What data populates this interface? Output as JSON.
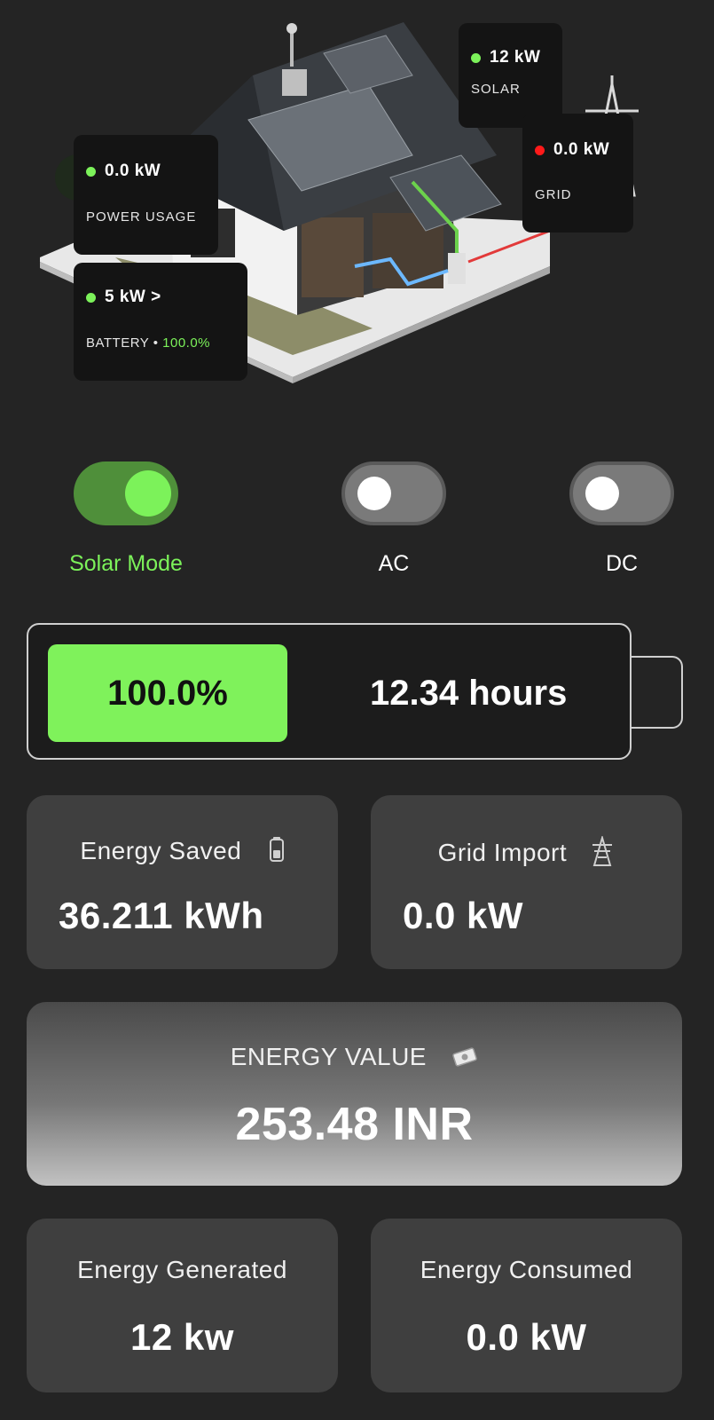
{
  "status": {
    "solar": {
      "value": "12 kW",
      "label": "SOLAR",
      "dot": "#7cf25a"
    },
    "grid": {
      "value": "0.0 kW",
      "label": "GRID",
      "dot": "#ff1a1a"
    },
    "power_usage": {
      "value": "0.0 kW",
      "label": "POWER USAGE",
      "dot": "#7cf25a"
    },
    "battery": {
      "value": "5 kW >",
      "label": "BATTERY",
      "separator": "•",
      "percent": "100.0%",
      "dot": "#7cf25a"
    }
  },
  "modes": [
    {
      "label": "Solar Mode",
      "on": true
    },
    {
      "label": "AC",
      "on": false
    },
    {
      "label": "DC",
      "on": false
    }
  ],
  "battery_bar": {
    "percent_text": "100.0%",
    "level": 1.0,
    "hours": "12.34 hours"
  },
  "cards": {
    "energy_saved": {
      "title": "Energy Saved",
      "value": "36.211 kWh",
      "icon": "battery-icon"
    },
    "grid_import": {
      "title": "Grid Import",
      "value": "0.0 kW",
      "icon": "transmission-tower-icon"
    },
    "energy_value": {
      "title": "ENERGY VALUE",
      "value": "253.48 INR",
      "icon": "money-icon"
    },
    "energy_generated": {
      "title": "Energy Generated",
      "value": "12 kw"
    },
    "energy_consumed": {
      "title": "Energy Consumed",
      "value": "0.0 kW"
    }
  },
  "colors": {
    "accent": "#7cf25a",
    "background": "#242424",
    "card": "#3f3f3f",
    "alert": "#ff1a1a"
  }
}
